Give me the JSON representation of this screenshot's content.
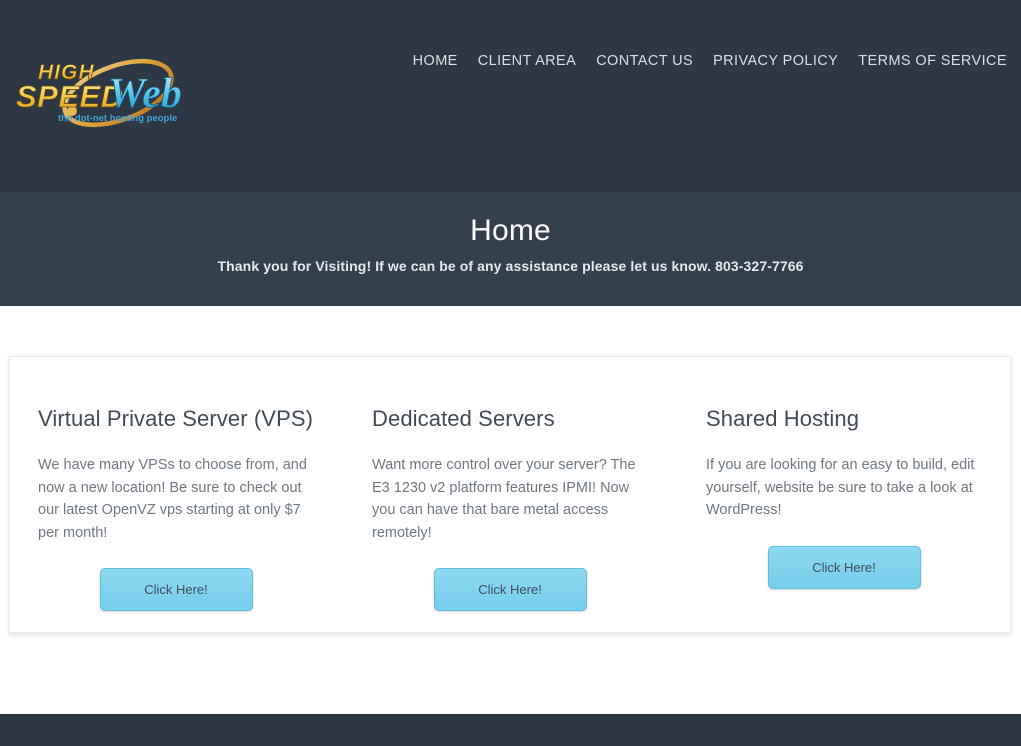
{
  "site": {
    "logo": {
      "word_high": "HIGH",
      "word_speed": "SPEED",
      "word_web": "Web",
      "tagline": "the dot-net hosting people",
      "color_gold": "#f2c94c",
      "color_blue": "#4fc3f7",
      "color_swoosh": "#e8a33d"
    },
    "nav": [
      {
        "label": "HOME"
      },
      {
        "label": "CLIENT AREA"
      },
      {
        "label": "CONTACT US"
      },
      {
        "label": "PRIVACY POLICY"
      },
      {
        "label": "TERMS OF SERVICE"
      }
    ],
    "colors": {
      "topbar_bg": "#2e3744",
      "banner_bg": "#343f4c",
      "footer_bg": "#2e3744",
      "button_bg": "#7dd3f0",
      "button_border": "#5fbcdd",
      "heading_text": "#414b57",
      "body_text": "#6e7883"
    }
  },
  "banner": {
    "title": "Home",
    "subtitle": "Thank you for Visiting! If we can be of any assistance please let us know. 803-327-7766",
    "phone": "803-327-7766"
  },
  "main": {
    "columns": [
      {
        "title": "Virtual Private Server (VPS)",
        "body": "We have many VPSs to choose from, and now a new location! Be sure to check out our latest OpenVZ vps starting at only $7 per month!",
        "button_label": "Click Here!"
      },
      {
        "title": "Dedicated Servers",
        "body": "Want more control over your server? The E3 1230 v2 platform features IPMI! Now you can have that bare metal access remotely!",
        "button_label": "Click Here!"
      },
      {
        "title": "Shared Hosting",
        "body": "If you are looking for an easy to build, edit yourself, website be sure to take a look at WordPress!",
        "button_label": "Click Here!"
      }
    ]
  }
}
